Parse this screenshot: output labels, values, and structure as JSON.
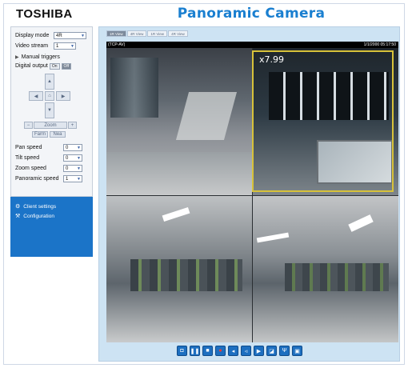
{
  "header": {
    "logo": "TOSHIBA",
    "title": "Panoramic Camera"
  },
  "left_panel": {
    "display_mode": {
      "label": "Display mode",
      "value": "4R"
    },
    "video_stream": {
      "label": "Video stream",
      "value": "1"
    },
    "manual_triggers": "Manual triggers",
    "digital_output": {
      "label": "Digital output",
      "on": "On",
      "off": "Off"
    },
    "zoom_label": "Zoom",
    "focus_buttons": [
      "Farm",
      "Nea"
    ],
    "speeds": [
      {
        "label": "Pan speed",
        "value": "0"
      },
      {
        "label": "Tilt speed",
        "value": "0"
      },
      {
        "label": "Zoom speed",
        "value": "0"
      },
      {
        "label": "Panoramic speed",
        "value": "1"
      }
    ]
  },
  "side_nav": {
    "items": [
      {
        "label": "Client settings",
        "icon": "gear-icon"
      },
      {
        "label": "Configuration",
        "icon": "wrench-icon"
      }
    ]
  },
  "video": {
    "tabs": [
      "1R View",
      "4R View",
      "1R View",
      "4R View"
    ],
    "status_left": "(TCP-AV)",
    "status_right": "1/1/2000 05:17:50",
    "zoom_level": "x7.99"
  },
  "toolbar": {
    "buttons": [
      "snapshot-icon",
      "pause-icon",
      "stop-icon",
      "record-icon",
      "volume-icon",
      "mute-icon",
      "speaker-icon",
      "talk-icon",
      "microphone-icon",
      "fullscreen-icon"
    ]
  },
  "colors": {
    "accent": "#1a7fd0",
    "nav_bg": "#1b74c8",
    "zoom_box": "#d7c23a",
    "video_panel": "#cde3f3"
  }
}
